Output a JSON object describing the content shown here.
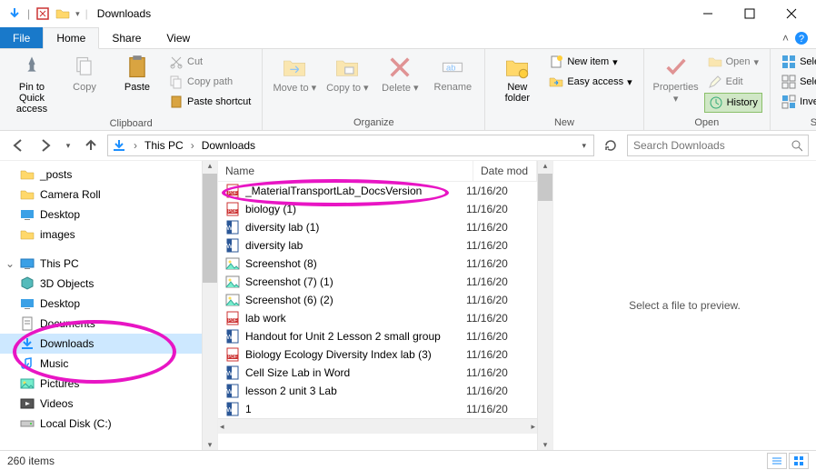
{
  "window": {
    "title": "Downloads"
  },
  "tabs": {
    "file": "File",
    "home": "Home",
    "share": "Share",
    "view": "View"
  },
  "ribbon": {
    "clipboard": {
      "label": "Clipboard",
      "pin": "Pin to Quick access",
      "copy": "Copy",
      "paste": "Paste",
      "cut": "Cut",
      "copypath": "Copy path",
      "pasteshortcut": "Paste shortcut"
    },
    "organize": {
      "label": "Organize",
      "moveto": "Move to",
      "copyto": "Copy to",
      "delete": "Delete",
      "rename": "Rename"
    },
    "new": {
      "label": "New",
      "newfolder": "New folder",
      "newitem": "New item",
      "easyaccess": "Easy access"
    },
    "open": {
      "label": "Open",
      "properties": "Properties",
      "open": "Open",
      "edit": "Edit",
      "history": "History"
    },
    "select": {
      "label": "Select",
      "selectall": "Select all",
      "selectnone": "Select none",
      "invert": "Invert selection"
    }
  },
  "breadcrumb": {
    "thispc": "This PC",
    "downloads": "Downloads"
  },
  "search": {
    "placeholder": "Search Downloads"
  },
  "nav": {
    "posts": "_posts",
    "cameraroll": "Camera Roll",
    "desktop": "Desktop",
    "images": "images",
    "thispc": "This PC",
    "objects3d": "3D Objects",
    "desktop2": "Desktop",
    "documents": "Documents",
    "downloads": "Downloads",
    "music": "Music",
    "pictures": "Pictures",
    "videos": "Videos",
    "localdisk": "Local Disk (C:)"
  },
  "columns": {
    "name": "Name",
    "date": "Date mod"
  },
  "files": [
    {
      "icon": "pdf",
      "name": "_MaterialTransportLab_DocsVersion",
      "date": "11/16/20"
    },
    {
      "icon": "pdf",
      "name": "biology (1)",
      "date": "11/16/20"
    },
    {
      "icon": "word",
      "name": "diversity lab  (1)",
      "date": "11/16/20"
    },
    {
      "icon": "word",
      "name": "diversity lab",
      "date": "11/16/20"
    },
    {
      "icon": "img",
      "name": "Screenshot (8)",
      "date": "11/16/20"
    },
    {
      "icon": "img",
      "name": "Screenshot (7) (1)",
      "date": "11/16/20"
    },
    {
      "icon": "img",
      "name": "Screenshot (6) (2)",
      "date": "11/16/20"
    },
    {
      "icon": "pdf",
      "name": "lab work",
      "date": "11/16/20"
    },
    {
      "icon": "word",
      "name": "Handout for Unit 2 Lesson 2 small group",
      "date": "11/16/20"
    },
    {
      "icon": "pdf",
      "name": "Biology Ecology Diversity Index lab (3)",
      "date": "11/16/20"
    },
    {
      "icon": "word",
      "name": "Cell Size Lab in Word",
      "date": "11/16/20"
    },
    {
      "icon": "word",
      "name": "lesson 2 unit 3 Lab",
      "date": "11/16/20"
    },
    {
      "icon": "word",
      "name": "1",
      "date": "11/16/20"
    }
  ],
  "preview": {
    "message": "Select a file to preview."
  },
  "status": {
    "count": "260 items"
  }
}
